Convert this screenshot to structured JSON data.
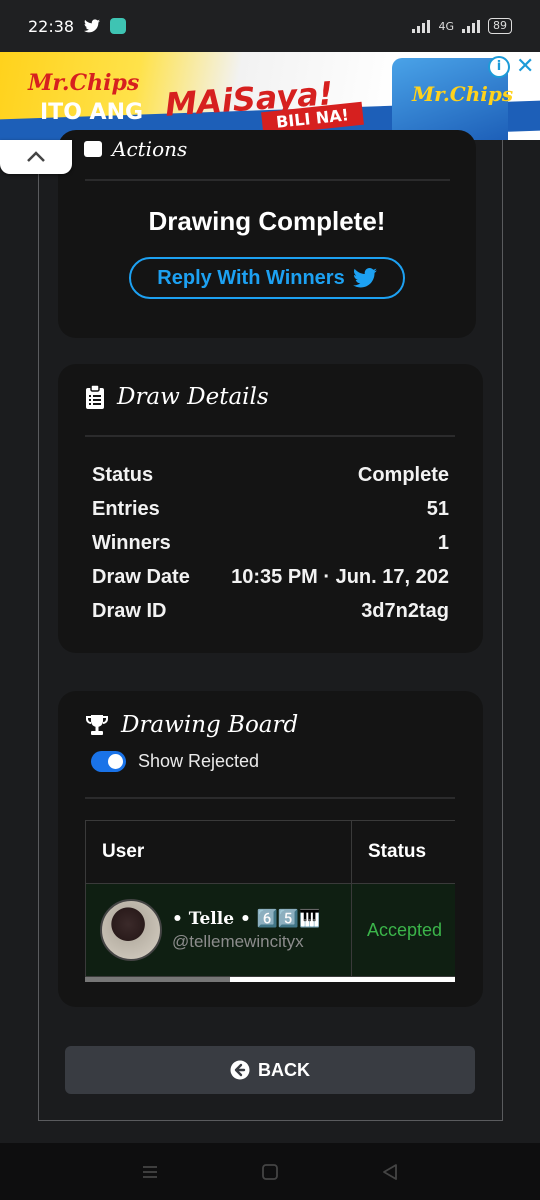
{
  "status_bar": {
    "time": "22:38",
    "network": "4G",
    "battery": "89"
  },
  "ad": {
    "brand": "Mr.Chips",
    "tagline_1": "ITO ANG",
    "tagline_2": "MAiSaya!",
    "cta": "BILI NA!",
    "pack_label": "Mr.Chips",
    "info_label": "i",
    "close_label": "✕"
  },
  "actions_card": {
    "header": "Actions",
    "heading": "Drawing Complete!",
    "reply_button": "Reply With Winners"
  },
  "draw_details": {
    "title": "Draw Details",
    "rows": [
      {
        "label": "Status",
        "value": "Complete"
      },
      {
        "label": "Entries",
        "value": "51"
      },
      {
        "label": "Winners",
        "value": "1"
      },
      {
        "label": "Draw Date",
        "value": "10:35 PM · Jun. 17, 202"
      },
      {
        "label": "Draw ID",
        "value": "3d7n2tag"
      }
    ]
  },
  "drawing_board": {
    "title": "Drawing Board",
    "toggle_label": "Show Rejected",
    "toggle_on": true,
    "columns": [
      "User",
      "Status"
    ],
    "entries": [
      {
        "name": "• Telle • 6️⃣5️⃣🎹",
        "handle": "@tellemewincityx",
        "status": "Accepted"
      }
    ]
  },
  "back_button": "BACK",
  "colors": {
    "accent_twitter": "#1da1f2",
    "accepted": "#3bb54a",
    "toggle": "#1a73e8"
  }
}
